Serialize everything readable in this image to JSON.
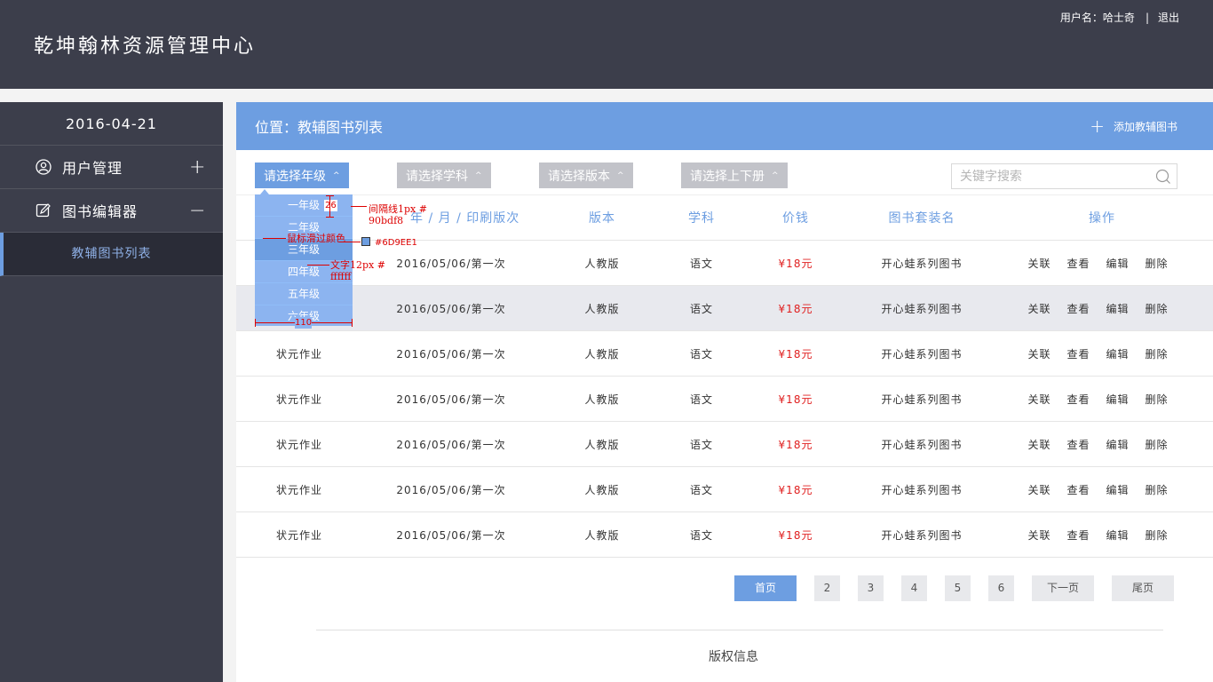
{
  "header": {
    "title": "乾坤翰林资源管理中心",
    "username_label": "用户名：哈士奇",
    "separator": "|",
    "logout": "退出"
  },
  "sidebar": {
    "date": "2016-04-21",
    "items": [
      {
        "label": "用户管理",
        "icon": "user-circle-icon",
        "toggle": "+"
      },
      {
        "label": "图书编辑器",
        "icon": "edit-icon",
        "toggle": "−"
      }
    ],
    "sub_item": "教辅图书列表"
  },
  "main": {
    "location": "位置：教辅图书列表",
    "add_label": "添加教辅图书",
    "filters": {
      "grade": "请选择年级",
      "subject": "请选择学科",
      "version": "请选择版本",
      "volume": "请选择上下册",
      "caret": "^"
    },
    "search_placeholder": "关键字搜索",
    "columns": [
      "",
      "年 / 月 / 印刷版次",
      "版本",
      "学科",
      "价钱",
      "图书套装名",
      "操作"
    ],
    "rows": [
      {
        "name": "",
        "date": "2016/05/06/第一次",
        "version": "人教版",
        "subject": "语文",
        "price": "¥18元",
        "set": "开心蛙系列图书"
      },
      {
        "name": "",
        "date": "2016/05/06/第一次",
        "version": "人教版",
        "subject": "语文",
        "price": "¥18元",
        "set": "开心蛙系列图书"
      },
      {
        "name": "状元作业",
        "date": "2016/05/06/第一次",
        "version": "人教版",
        "subject": "语文",
        "price": "¥18元",
        "set": "开心蛙系列图书"
      },
      {
        "name": "状元作业",
        "date": "2016/05/06/第一次",
        "version": "人教版",
        "subject": "语文",
        "price": "¥18元",
        "set": "开心蛙系列图书"
      },
      {
        "name": "状元作业",
        "date": "2016/05/06/第一次",
        "version": "人教版",
        "subject": "语文",
        "price": "¥18元",
        "set": "开心蛙系列图书"
      },
      {
        "name": "状元作业",
        "date": "2016/05/06/第一次",
        "version": "人教版",
        "subject": "语文",
        "price": "¥18元",
        "set": "开心蛙系列图书"
      },
      {
        "name": "状元作业",
        "date": "2016/05/06/第一次",
        "version": "人教版",
        "subject": "语文",
        "price": "¥18元",
        "set": "开心蛙系列图书"
      }
    ],
    "ops": [
      "关联",
      "查看",
      "编辑",
      "删除"
    ]
  },
  "dropdown": {
    "items": [
      "一年级",
      "二年级",
      "三年级",
      "四年级",
      "五年级",
      "六年级"
    ],
    "hover_index": 2
  },
  "annotations": {
    "height": "26",
    "divider": "间隔线1px #\n90bdf8",
    "hover": "鼠标滑过颜色",
    "hover_color": "#6D9EE1",
    "text": "文字12px #\nffffff",
    "width": "110"
  },
  "pagination": {
    "first": "首页",
    "pages": [
      "2",
      "3",
      "4",
      "5",
      "6"
    ],
    "next": "下一页",
    "last": "尾页"
  },
  "footer": "版权信息",
  "colors": {
    "header_bg": "#3c3e4b",
    "accent": "#6d9ee1",
    "dropdown_bg": "#8cb4f0",
    "divider": "#90bdf8",
    "price": "#e02020"
  }
}
